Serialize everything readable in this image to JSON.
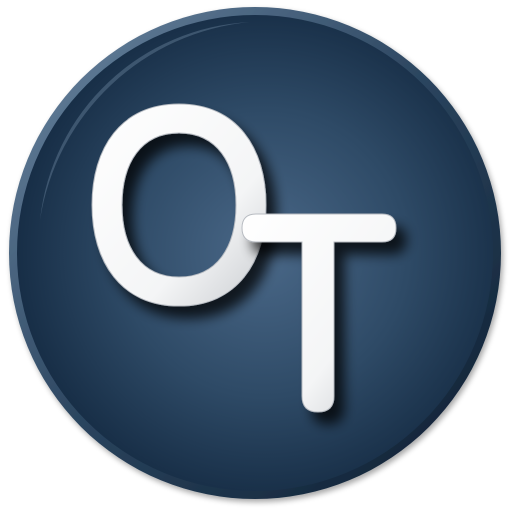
{
  "logo": {
    "monogram": "OT",
    "icon": "ot-monogram-logo-icon",
    "colors": {
      "disc_center": "#4a6888",
      "disc_mid": "#2e4a66",
      "disc_edge": "#142a42",
      "rim_light": "#6f8aa6",
      "rim_dark": "#0c1c2e",
      "letter_face": "#ffffff",
      "letter_shade": "#c9ccd0",
      "shadow": "#071220"
    }
  }
}
